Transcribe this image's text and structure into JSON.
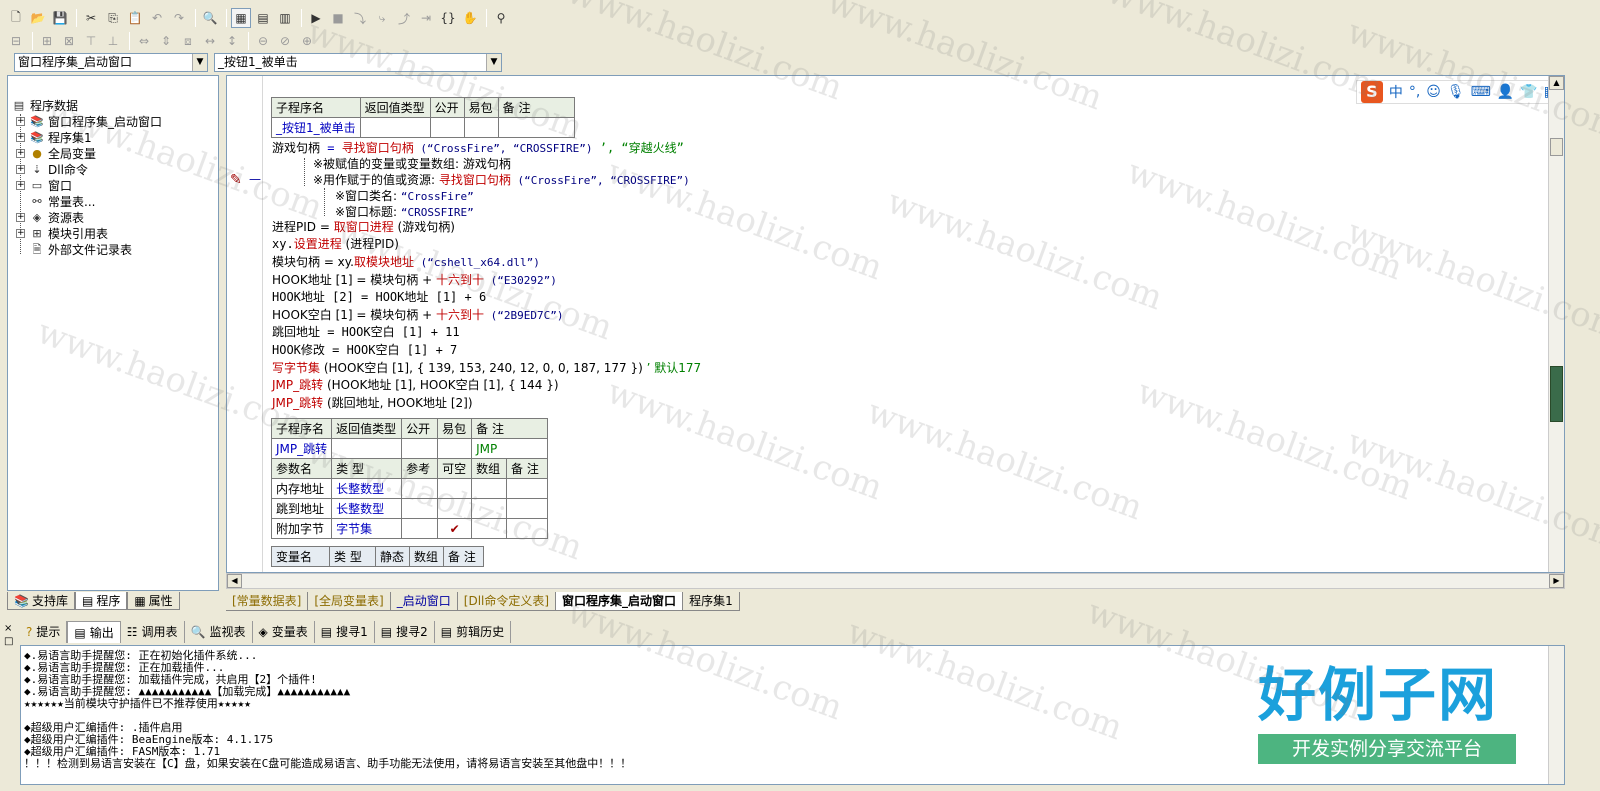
{
  "combos": {
    "left": "窗口程序集_启动窗口",
    "right": "_按钮1_被单击"
  },
  "tree": {
    "root": "程序数据",
    "items": [
      {
        "label": "窗口程序集_启动窗口",
        "icon": "book-icon"
      },
      {
        "label": "程序集1",
        "icon": "book-icon"
      },
      {
        "label": "全局变量",
        "icon": "globe-icon"
      },
      {
        "label": "Dll命令",
        "icon": "dll-icon"
      },
      {
        "label": "窗口",
        "icon": "window-icon"
      },
      {
        "label": "常量表...",
        "icon": "constant-icon"
      },
      {
        "label": "资源表",
        "icon": "resource-icon"
      },
      {
        "label": "模块引用表",
        "icon": "module-icon"
      },
      {
        "label": "外部文件记录表",
        "icon": "file-icon"
      }
    ]
  },
  "left_tabs": [
    "支持库",
    "程序",
    "属性"
  ],
  "sub1": {
    "headers": [
      "子程序名",
      "返回值类型",
      "公开",
      "易包",
      "备 注"
    ],
    "name": "_按钮1_被单击"
  },
  "code": {
    "l1_a": "游戏句柄",
    "l1_eq": " = ",
    "l1_fn": "寻找窗口句柄",
    "l1_args": " (“CrossFire”, “CROSSFIRE”)",
    "l1_comment": " ’, “穿越火线”",
    "c1": "※被赋值的变量或变量数组: 游戏句柄",
    "c2_a": "※用作赋于的值或资源: ",
    "c2_fn": "寻找窗口句柄",
    "c2_args": " (“CrossFire”, “CROSSFIRE”)",
    "c3_a": "※窗口类名: ",
    "c3_b": "“CrossFire”",
    "c4_a": "※窗口标题: ",
    "c4_b": "“CROSSFIRE”",
    "l2_a": "进程PID = ",
    "l2_fn": "取窗口进程",
    "l2_b": " (游戏句柄)",
    "l3_a": "xy.",
    "l3_fn": "设置进程",
    "l3_b": " (进程PID)",
    "l4_a": "模块句柄 = xy.",
    "l4_fn": "取模块地址",
    "l4_b": " (“cshell_x64.dll”)",
    "l5_a": "HOOK地址 [1] = 模块句柄 + ",
    "l5_fn": "十六到十",
    "l5_b": " (“E30292”)",
    "l6": "HOOK地址 [2] = HOOK地址 [1] + 6",
    "l7_a": "HOOK空白 [1] = 模块句柄 + ",
    "l7_fn": "十六到十",
    "l7_b": " (“2B9ED7C”)",
    "l8": "跳回地址 = HOOK空白 [1] + 11",
    "l9": "HOOK修改 = HOOK空白 [1] + 7",
    "l10_fn": "写字节集",
    "l10_b": " (HOOK空白 [1], { 139, 153, 240, 12, 0, 0, 187, 177 })",
    "l10_c": " ’ 默认177",
    "l11_fn": "JMP_跳转",
    "l11_b": " (HOOK地址 [1], HOOK空白 [1], { 144 })",
    "l12_fn": "JMP_跳转",
    "l12_b": " (跳回地址, HOOK地址 [2])"
  },
  "sub2": {
    "headers": [
      "子程序名",
      "返回值类型",
      "公开",
      "易包",
      "备 注"
    ],
    "name": "JMP_跳转",
    "note": "JMP",
    "param_headers": [
      "参数名",
      "类 型",
      "参考",
      "可空",
      "数组",
      "备 注"
    ],
    "params": [
      {
        "name": "内存地址",
        "type": "长整数型"
      },
      {
        "name": "跳到地址",
        "type": "长整数型"
      },
      {
        "name": "附加字节",
        "type": "字节集",
        "nullable": "✔"
      }
    ],
    "var_headers": [
      "变量名",
      "类 型",
      "静态",
      "数组",
      "备 注"
    ]
  },
  "editor_tabs": [
    "[常量数据表]",
    "[全局变量表]",
    "_启动窗口",
    "[Dll命令定义表]",
    "窗口程序集_启动窗口",
    "程序集1"
  ],
  "bottom_tabs": [
    {
      "label": "提示",
      "icon": "hint-icon"
    },
    {
      "label": "输出",
      "icon": "output-icon"
    },
    {
      "label": "调用表",
      "icon": "call-icon"
    },
    {
      "label": "监视表",
      "icon": "watch-icon"
    },
    {
      "label": "变量表",
      "icon": "variable-icon"
    },
    {
      "label": "搜寻1",
      "icon": "search-icon"
    },
    {
      "label": "搜寻2",
      "icon": "search-icon"
    },
    {
      "label": "剪辑历史",
      "icon": "clipboard-icon"
    }
  ],
  "output_lines": [
    "◆.易语言助手提醒您: 正在初始化插件系统...",
    "◆.易语言助手提醒您: 正在加载插件...",
    "◆.易语言助手提醒您: 加载插件完成，共启用【2】个插件!",
    "◆.易语言助手提醒您: ▲▲▲▲▲▲▲▲▲▲▲【加载完成】▲▲▲▲▲▲▲▲▲▲▲",
    "★★★★★★当前模块守护插件已不推荐使用★★★★★",
    "",
    "◆超级用户汇编插件: .插件启用",
    "◆超级用户汇编插件: BeaEngine版本: 4.1.175",
    "◆超级用户汇编插件: FASM版本: 1.71",
    "！！！检测到易语言安装在【C】盘，如果安装在C盘可能造成易语言、助手功能无法使用，请将易语言安装至其他盘中！！！"
  ],
  "ime": {
    "lang": "中"
  },
  "logo": {
    "title": "好例子网",
    "subtitle": "开发实例分享交流平台"
  },
  "watermark": "www.haolizi.com"
}
